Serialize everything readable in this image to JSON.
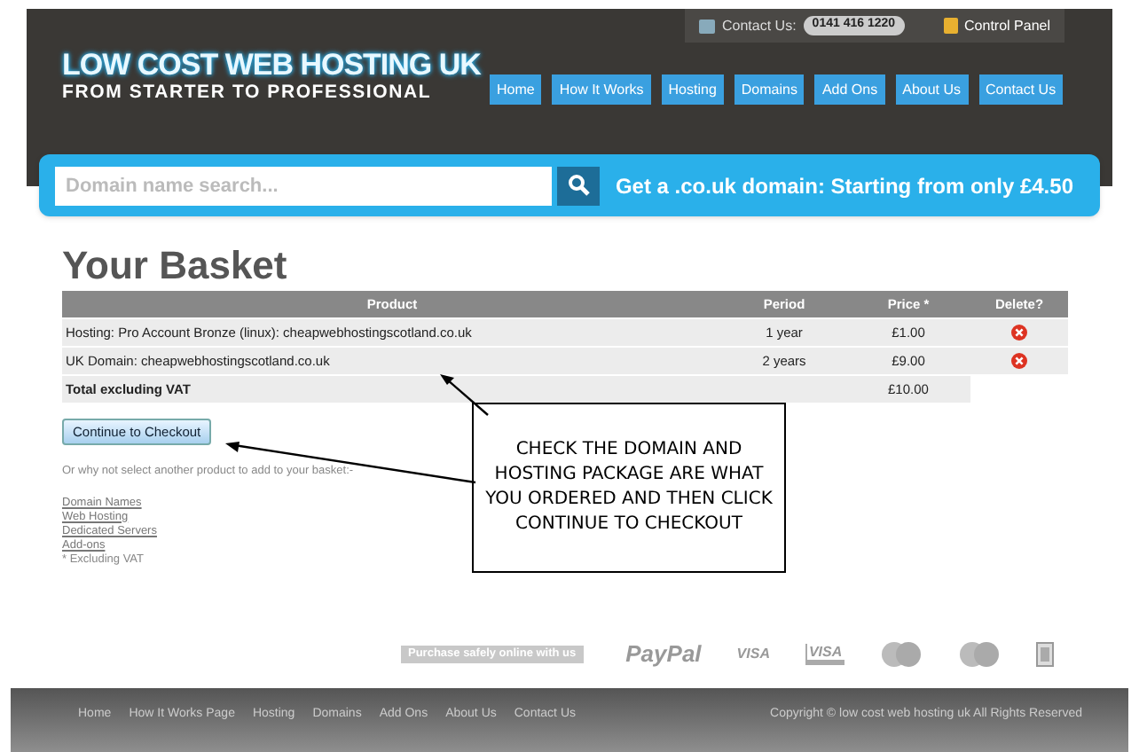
{
  "top_bar": {
    "contact_label": "Contact Us:",
    "phone": "0141 416 1220",
    "control_panel": "Control Panel"
  },
  "logo": {
    "title": "LOW COST WEB HOSTING UK",
    "tagline": "FROM STARTER TO PROFESSIONAL"
  },
  "nav": [
    "Home",
    "How It Works",
    "Hosting",
    "Domains",
    "Add Ons",
    "About Us",
    "Contact Us"
  ],
  "search": {
    "placeholder": "Domain name search...",
    "promo": "Get a .co.uk domain: Starting from only £4.50"
  },
  "heading": "Your Basket",
  "table": {
    "columns": [
      "Product",
      "Period",
      "Price *",
      "Delete?"
    ],
    "rows": [
      {
        "product": "Hosting: Pro Account Bronze (linux): cheapwebhostingscotland.co.uk",
        "period": "1 year",
        "price": "£1.00"
      },
      {
        "product": "UK Domain: cheapwebhostingscotland.co.uk",
        "period": "2 years",
        "price": "£9.00"
      }
    ],
    "total": {
      "label": "Total excluding VAT",
      "price": "£10.00"
    }
  },
  "checkout_button": "Continue to Checkout",
  "suggestion": "Or why not select another product to add to your basket:-",
  "links": [
    "Domain Names",
    "Web Hosting",
    "Dedicated Servers",
    "Add-ons"
  ],
  "footnote": "* Excluding VAT",
  "callout": "CHECK THE DOMAIN AND HOSTING PACKAGE ARE WHAT YOU ORDERED AND THEN CLICK CONTINUE TO CHECKOUT",
  "payment": {
    "label": "Purchase safely online with us",
    "logos": [
      {
        "kind": "wordmark",
        "text": "PayPal"
      },
      {
        "kind": "wordmark",
        "text": "VISA"
      },
      {
        "kind": "boxed",
        "text": "VISA"
      },
      {
        "kind": "circles"
      },
      {
        "kind": "circles"
      },
      {
        "kind": "badge"
      }
    ]
  },
  "footer": {
    "links": [
      "Home",
      "How It Works Page",
      "Hosting",
      "Domains",
      "Add Ons",
      "About Us",
      "Contact Us"
    ],
    "copyright": "Copyright © low cost web hosting uk All Rights Reserved"
  }
}
